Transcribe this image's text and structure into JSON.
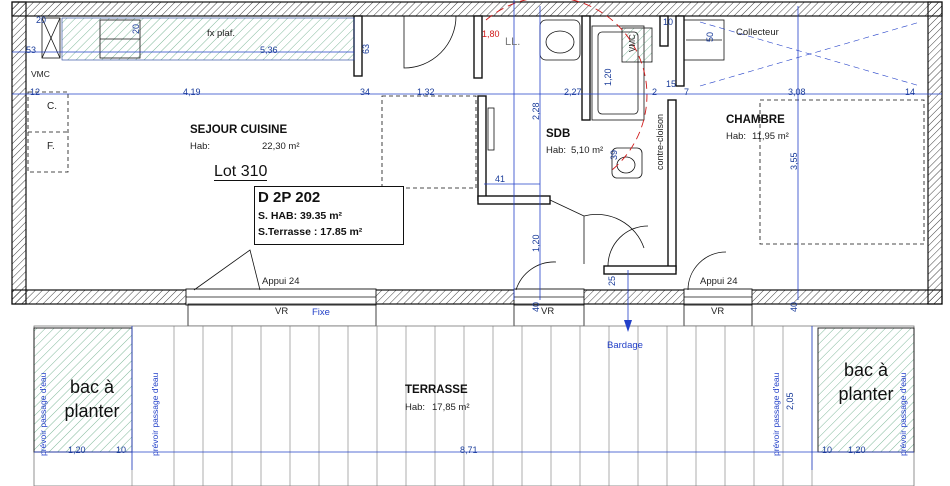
{
  "lot": "Lot 310",
  "apartment": {
    "code": "D 2P 202",
    "surface_hab": "S. HAB: 39.35 m²",
    "surface_terrace": "S.Terrasse : 17.85 m²"
  },
  "rooms": {
    "sejour": {
      "name": "SEJOUR CUISINE",
      "hab_label": "Hab:",
      "hab_value": "22,30 m²"
    },
    "sdb": {
      "name": "SDB",
      "hab_label": "Hab:",
      "hab_value": "5,10 m²"
    },
    "chambre": {
      "name": "CHAMBRE",
      "hab_label": "Hab:",
      "hab_value": "11,95 m²"
    },
    "terrasse": {
      "name": "TERRASSE",
      "hab_label": "Hab:",
      "hab_value": "17,85 m²"
    }
  },
  "annotations": {
    "fx_plaf": "fx plaf.",
    "vmc_left": "VMC",
    "vmc_sdb": "VMC",
    "ll": "LL.",
    "collecteur": "Collecteur",
    "contre_cloison": "contre-cloison",
    "appui_left": "Appui 24",
    "appui_right": "Appui 24",
    "vr": "VR",
    "fixe": "Fixe",
    "bardage": "Bardage",
    "planter_1": "bac à",
    "planter_2": "planter",
    "prevoir_eau": "prévoir passage d'eau",
    "c_letter": "C.",
    "f_letter": "F."
  },
  "dimensions": {
    "d_536": "5,36",
    "d_419": "4,19",
    "d_34": "34",
    "d_132": "1,32",
    "d_227": "2,27",
    "d_308": "3,08",
    "d_14": "14",
    "d_12": "12",
    "d_7a": "7",
    "d_7b": "7",
    "d_2": "2",
    "d_15": "15",
    "d_180": "1,80",
    "d_120a": "1,20",
    "d_228": "2,28",
    "d_41": "41",
    "d_120b": "1,20",
    "d_355": "3,55",
    "d_40a": "40",
    "d_40b": "40",
    "d_25": "25",
    "d_39": "39",
    "d_20a": "20",
    "d_20b": "20",
    "d_10a": "10",
    "d_10b": "10",
    "d_10c": "10",
    "d_50": "50",
    "d_53": "53",
    "d_63": "63",
    "d_871": "8,71",
    "d_120c": "1,20",
    "d_120d": "1,20",
    "d_205": "2,05"
  }
}
